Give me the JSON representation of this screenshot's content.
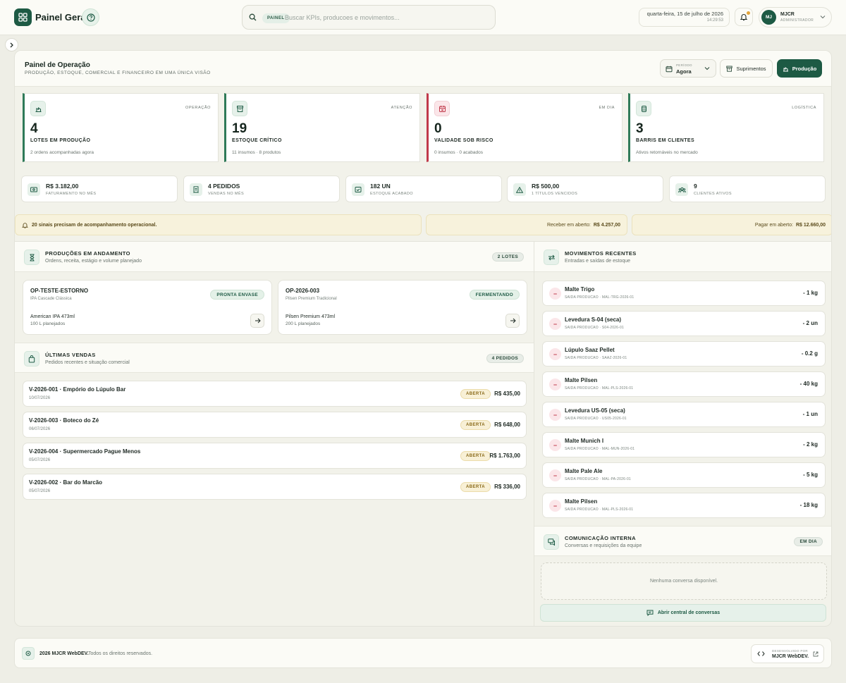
{
  "app": {
    "brand": "Painel Geral"
  },
  "search": {
    "tag": "PAINEL",
    "placeholder": "Buscar KPIs, producoes e movimentos..."
  },
  "datetime": {
    "date": "quarta-feira, 15 de julho de 2026",
    "time": "14:29:53"
  },
  "user": {
    "initials": "MJ",
    "name": "MJCR",
    "role": "ADMINISTRADOR"
  },
  "header": {
    "title": "Painel de Operação",
    "subtitle": "PRODUÇÃO, ESTOQUE, COMERCIAL E FINANCEIRO EM UMA ÚNICA VISÃO",
    "period_label": "PERÍODO",
    "period_value": "Agora",
    "supplies_label": "Suprimentos",
    "production_label": "Produção"
  },
  "kpis": [
    {
      "tag": "OPERAÇÃO",
      "value": "4",
      "label": "LOTES EM PRODUÇÃO",
      "sub": "2 ordens acompanhadas agora",
      "color": "#2f7a58",
      "icon": "production-icon"
    },
    {
      "tag": "ATENÇÃO",
      "value": "19",
      "label": "ESTOQUE CRÍTICO",
      "sub": "11 insumos · 8 produtos",
      "color": "#2f7a58",
      "icon": "box-icon"
    },
    {
      "tag": "EM DIA",
      "value": "0",
      "label": "VALIDADE SOB RISCO",
      "sub": "0 insumos · 0 acabados",
      "color": "#c0394a",
      "icon": "calendar-icon"
    },
    {
      "tag": "LOGÍSTICA",
      "value": "3",
      "label": "BARRIS EM CLIENTES",
      "sub": "Ativos retornáveis no mercado",
      "color": "#2f7a58",
      "icon": "barrel-icon"
    }
  ],
  "stats": [
    {
      "value": "R$ 3.182,00",
      "label": "FATURAMENTO NO MÊS",
      "icon": "cash-icon"
    },
    {
      "value": "4 PEDIDOS",
      "label": "VENDAS NO MÊS",
      "icon": "receipt-icon"
    },
    {
      "value": "182 UN",
      "label": "ESTOQUE ACABADO",
      "icon": "stock-icon"
    },
    {
      "value": "R$ 500,00",
      "label": "1 TÍTULOS VENCIDOS",
      "icon": "warning-icon"
    },
    {
      "value": "9",
      "label": "CLIENTES ATIVOS",
      "icon": "users-icon"
    }
  ],
  "alerts": {
    "signals": "20 sinais precisam de acompanhamento operacional.",
    "receive_label": "Receber em aberto:",
    "receive_value": "R$ 4.257,00",
    "pay_label": "Pagar em aberto:",
    "pay_value": "R$ 12.660,00"
  },
  "productions": {
    "title": "PRODUÇÕES EM ANDAMENTO",
    "subtitle": "Ordens, receita, estágio e volume planejado",
    "badge": "2 LOTES",
    "items": [
      {
        "code": "OP-TESTE-ESTORNO",
        "recipe": "IPA Cascade Clássica",
        "status": "PRONTA ENVASE",
        "product": "American IPA 473ml",
        "volume": "100 L planejados"
      },
      {
        "code": "OP-2026-003",
        "recipe": "Pilsen Premium Tradicional",
        "status": "FERMENTANDO",
        "product": "Pilsen Premium 473ml",
        "volume": "200 L planejados"
      }
    ]
  },
  "sales": {
    "title": "ÚLTIMAS VENDAS",
    "subtitle": "Pedidos recentes e situação comercial",
    "badge": "4 PEDIDOS",
    "items": [
      {
        "title": "V-2026-001 · Empório do Lúpulo Bar",
        "date": "10/07/2026",
        "status": "ABERTA",
        "amount": "R$ 435,00"
      },
      {
        "title": "V-2026-003 · Boteco do Zé",
        "date": "06/07/2026",
        "status": "ABERTA",
        "amount": "R$ 648,00"
      },
      {
        "title": "V-2026-004 · Supermercado Pague Menos",
        "date": "05/07/2026",
        "status": "ABERTA",
        "amount": "R$ 1.763,00"
      },
      {
        "title": "V-2026-002 · Bar do Marcão",
        "date": "05/07/2026",
        "status": "ABERTA",
        "amount": "R$ 336,00"
      }
    ]
  },
  "movements": {
    "title": "MOVIMENTOS RECENTES",
    "subtitle": "Entradas e saídas de estoque",
    "items": [
      {
        "name": "Malte Trigo",
        "ref": "SAIDA PRODUCAO · MAL-TRG-2026-01",
        "qty": "- 1 kg"
      },
      {
        "name": "Levedura S-04 (seca)",
        "ref": "SAIDA PRODUCAO · S04-2026-01",
        "qty": "- 2 un"
      },
      {
        "name": "Lúpulo Saaz Pellet",
        "ref": "SAIDA PRODUCAO · SAAZ-2026-01",
        "qty": "- 0.2 g"
      },
      {
        "name": "Malte Pilsen",
        "ref": "SAIDA PRODUCAO · MAL-PLS-2026-01",
        "qty": "- 40 kg"
      },
      {
        "name": "Levedura US-05 (seca)",
        "ref": "SAIDA PRODUCAO · US05-2026-01",
        "qty": "- 1 un"
      },
      {
        "name": "Malte Munich I",
        "ref": "SAIDA PRODUCAO · MAL-MUN-2026-01",
        "qty": "- 2 kg"
      },
      {
        "name": "Malte Pale Ale",
        "ref": "SAIDA PRODUCAO · MAL-PA-2026-01",
        "qty": "- 5 kg"
      },
      {
        "name": "Malte Pilsen",
        "ref": "SAIDA PRODUCAO · MAL-PLS-2026-01",
        "qty": "- 18 kg"
      }
    ]
  },
  "chat": {
    "title": "COMUNICAÇÃO INTERNA",
    "subtitle": "Conversas e requisições da equipe",
    "badge": "EM DIA",
    "empty": "Nenhuma conversa disponível.",
    "open_label": "Abrir central de conversas"
  },
  "footer": {
    "brand": "2026 MJCR WebDEV.",
    "rights": "Todos os direitos reservados.",
    "dev_label": "DESENVOLVIDO POR",
    "dev_name": "MJCR WebDEV."
  }
}
